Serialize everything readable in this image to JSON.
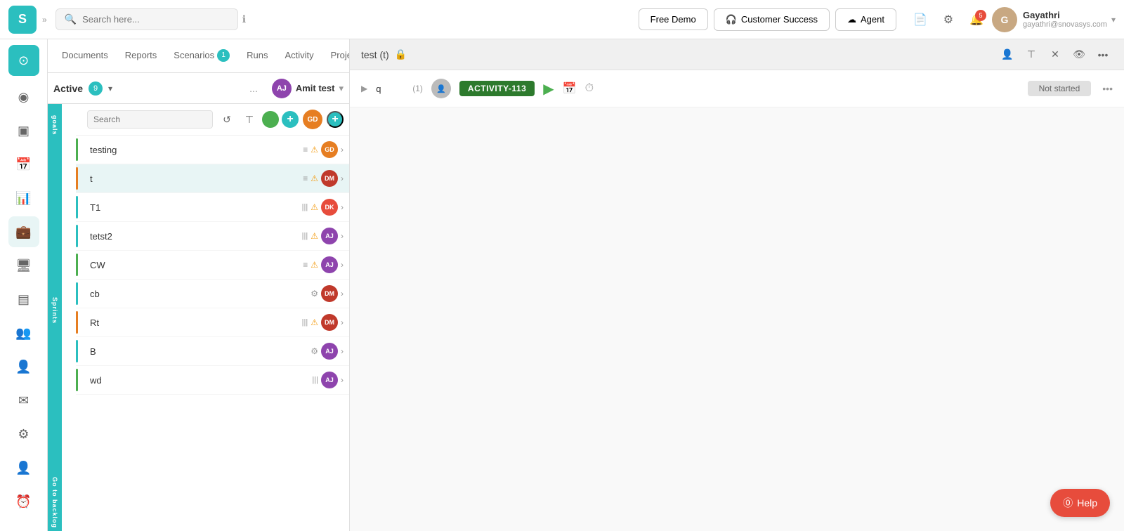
{
  "header": {
    "logo_text": "S",
    "search_placeholder": "Search here...",
    "free_demo_label": "Free Demo",
    "customer_success_label": "Customer Success",
    "agent_label": "Agent",
    "notif_count": "5",
    "user_name": "Gayathri",
    "user_email": "gayathri@snovasys.com",
    "user_initials": "G"
  },
  "sidebar": {
    "items": [
      {
        "id": "logo",
        "icon": "◎",
        "label": "Logo"
      },
      {
        "id": "globe",
        "icon": "◉",
        "label": "Globe"
      },
      {
        "id": "tv",
        "icon": "▣",
        "label": "TV"
      },
      {
        "id": "calendar",
        "icon": "📅",
        "label": "Calendar"
      },
      {
        "id": "reports",
        "icon": "📊",
        "label": "Reports"
      },
      {
        "id": "briefcase",
        "icon": "💼",
        "label": "Briefcase"
      },
      {
        "id": "monitor",
        "icon": "🖥",
        "label": "Monitor"
      },
      {
        "id": "card",
        "icon": "▤",
        "label": "Card"
      },
      {
        "id": "team",
        "icon": "👥",
        "label": "Team"
      },
      {
        "id": "people",
        "icon": "👤",
        "label": "People"
      },
      {
        "id": "mail",
        "icon": "✉",
        "label": "Mail"
      },
      {
        "id": "settings",
        "icon": "⚙",
        "label": "Settings"
      },
      {
        "id": "user",
        "icon": "👤",
        "label": "User"
      },
      {
        "id": "clock",
        "icon": "⏰",
        "label": "Clock"
      }
    ]
  },
  "tabs": [
    {
      "id": "documents",
      "label": "Documents",
      "active": false
    },
    {
      "id": "reports",
      "label": "Reports",
      "active": false
    },
    {
      "id": "scenarios",
      "label": "Scenarios",
      "active": false,
      "badge": "1"
    },
    {
      "id": "runs",
      "label": "Runs",
      "active": false
    },
    {
      "id": "activity",
      "label": "Activity",
      "active": false
    },
    {
      "id": "project_summary",
      "label": "Project summary",
      "active": false
    }
  ],
  "active_section": {
    "label": "Active",
    "count": "9",
    "more_label": "..."
  },
  "sprint_labels": {
    "goals": "goals",
    "sprints": "Sprints",
    "backlog": "Go to backlog"
  },
  "search": {
    "placeholder": "Search",
    "label": "Search"
  },
  "projects": [
    {
      "id": "testing",
      "name": "testing",
      "color": "#4caf50",
      "icons": "list+warn",
      "avatar": "GD",
      "selected": false
    },
    {
      "id": "t",
      "name": "t",
      "color": "#e67e22",
      "icons": "list+warn",
      "avatar": "DM",
      "selected": true
    },
    {
      "id": "T1",
      "name": "T1",
      "color": "#2bbfbf",
      "icons": "bars+warn",
      "avatar": "DK",
      "selected": false
    },
    {
      "id": "tetst2",
      "name": "tetst2",
      "color": "#2bbfbf",
      "icons": "bars+warn",
      "avatar": "AJ",
      "selected": false
    },
    {
      "id": "CW",
      "name": "CW",
      "color": "#4caf50",
      "icons": "list+warn",
      "avatar": "AJ",
      "selected": false
    },
    {
      "id": "cb",
      "name": "cb",
      "color": "#2bbfbf",
      "icons": "gear",
      "avatar": "DM",
      "selected": false
    },
    {
      "id": "Rt",
      "name": "Rt",
      "color": "#e67e22",
      "icons": "bars+warn",
      "avatar": "DM",
      "selected": false
    },
    {
      "id": "B",
      "name": "B",
      "color": "#2bbfbf",
      "icons": "gear",
      "avatar": "AJ",
      "selected": false
    },
    {
      "id": "wd",
      "name": "wd",
      "color": "#4caf50",
      "icons": "bars",
      "avatar": "AJ",
      "selected": false
    }
  ],
  "content": {
    "title": "test (t)",
    "lock_icon": "🔒",
    "workspace_label": "Amit test",
    "workspace_arrow": "▾"
  },
  "activity_row": {
    "expand_icon": "▶",
    "name": "q",
    "count": "(1)",
    "badge_label": "ACTIVITY-113",
    "status_label": "Not started"
  },
  "help_btn": {
    "label": "Help",
    "icon": "?"
  }
}
